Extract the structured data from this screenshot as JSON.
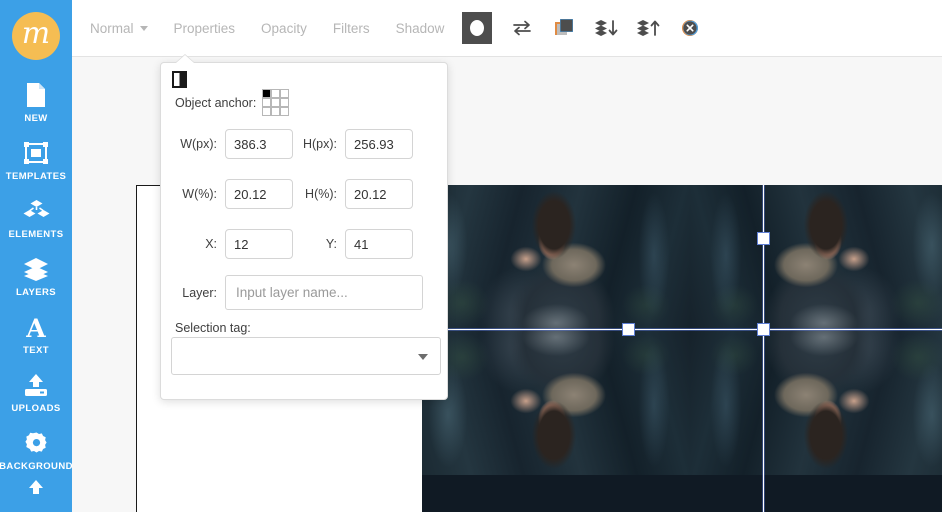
{
  "app": {
    "logo_letter": "m",
    "logo_color": "#f5bd53",
    "sidebar_color": "#3ca0e7"
  },
  "sidebar": {
    "items": [
      {
        "icon": "new-document-icon",
        "label": "NEW"
      },
      {
        "icon": "templates-icon",
        "label": "TEMPLATES"
      },
      {
        "icon": "elements-icon",
        "label": "ELEMENTS"
      },
      {
        "icon": "layers-icon",
        "label": "LAYERS"
      },
      {
        "icon": "text-icon",
        "label": "TEXT"
      },
      {
        "icon": "uploads-icon",
        "label": "UPLOADS"
      },
      {
        "icon": "background-gear-icon",
        "label": "BACKGROUND"
      }
    ]
  },
  "toolbar": {
    "blend_mode": "Normal",
    "tabs": [
      {
        "label": "Properties"
      },
      {
        "label": "Opacity"
      },
      {
        "label": "Filters"
      },
      {
        "label": "Shadow"
      }
    ],
    "icons": [
      {
        "name": "mask-ellipse-icon",
        "active": true
      },
      {
        "name": "flip-swap-icon",
        "active": false
      },
      {
        "name": "duplicate-layer-icon",
        "active": false
      },
      {
        "name": "send-layer-down-icon",
        "active": false
      },
      {
        "name": "bring-layer-up-icon",
        "active": false
      },
      {
        "name": "delete-layer-icon",
        "active": false
      }
    ]
  },
  "properties_panel": {
    "anchor_label": "Object anchor:",
    "anchor_selected_index": 0,
    "fields": {
      "w_px_label": "W(px):",
      "w_px_value": "386.3",
      "h_px_label": "H(px):",
      "h_px_value": "256.93",
      "w_pct_label": "W(%):",
      "w_pct_value": "20.12",
      "h_pct_label": "H(%):",
      "h_pct_value": "20.12",
      "x_label": "X:",
      "x_value": "12",
      "y_label": "Y:",
      "y_value": "41"
    },
    "layer_label": "Layer:",
    "layer_placeholder": "Input layer name...",
    "layer_value": "",
    "selection_tag_label": "Selection tag:",
    "selection_tag_value": ""
  },
  "canvas": {
    "selection_handle_color": "#5f7fd4",
    "selection_line_color": "#ffffff",
    "photo_alt": "woman-in-winter-parka-photo"
  }
}
